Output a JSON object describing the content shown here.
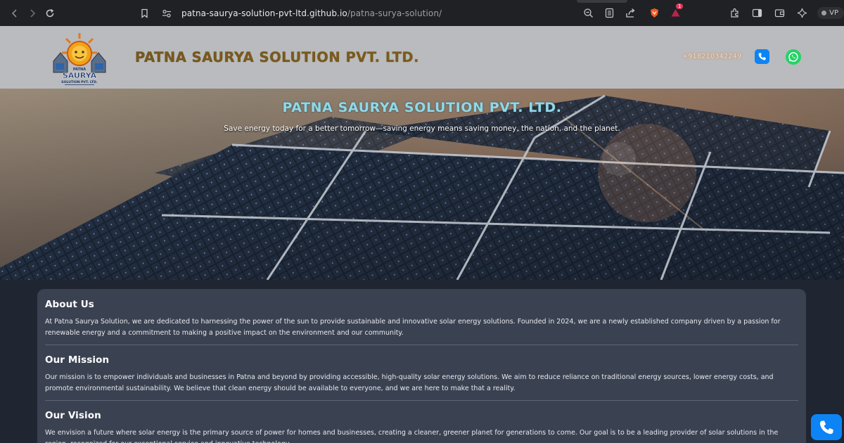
{
  "browser": {
    "url_host": "patna-saurya-solution-pvt-ltd.github.io",
    "url_path": "/patna-surya-solution/",
    "notification_count": "1",
    "vpn_label": "VP",
    "icons": [
      "back-icon",
      "forward-icon",
      "reload-icon",
      "bookmark-icon",
      "site-settings-icon",
      "zoom-icon",
      "reader-icon",
      "share-icon",
      "brave-shield-icon",
      "rewards-icon",
      "extensions-icon",
      "sidebar-icon",
      "wallet-icon",
      "leo-ai-icon"
    ]
  },
  "header": {
    "logo": {
      "top_text": "PATNA",
      "main_text": "SAURYA",
      "bottom_text": "SOLUTION PVT. LTD."
    },
    "brand_name": "PATNA SAURYA SOLUTION PVT. LTD.",
    "phone": "+918210342249",
    "icons": [
      "phone-icon",
      "whatsapp-icon"
    ]
  },
  "hero": {
    "title": "PATNA SAURYA SOLUTION PVT. LTD.",
    "subtitle": "Save energy today for a better tomorrow—saving energy means saving money, the nation, and the planet."
  },
  "sections": [
    {
      "heading": "About Us",
      "body": "At Patna Saurya Solution, we are dedicated to harnessing the power of the sun to provide sustainable and innovative solar energy solutions. Founded in 2024, we are a newly established company driven by a passion for renewable energy and a commitment to making a positive impact on the environment and our community."
    },
    {
      "heading": "Our Mission",
      "body": "Our mission is to empower individuals and businesses in Patna and beyond by providing accessible, high-quality solar energy solutions. We aim to reduce reliance on traditional energy sources, lower energy costs, and promote environmental sustainability. We believe that clean energy should be available to everyone, and we are here to make that a reality."
    },
    {
      "heading": "Our Vision",
      "body": "We envision a future where solar energy is the primary source of power for homes and businesses, creating a cleaner, greener planet for generations to come. Our goal is to be a leading provider of solar solutions in the region, recognized for our exceptional service and innovative technology."
    }
  ],
  "colors": {
    "header_bg": "#b9bbbe",
    "brand_text": "#5a4318",
    "hero_title": "#8fd8e8",
    "content_bg": "#1f2531",
    "card_bg": "#3a4252",
    "call_blue": "#0d84f5",
    "whatsapp_green": "#25d366"
  }
}
